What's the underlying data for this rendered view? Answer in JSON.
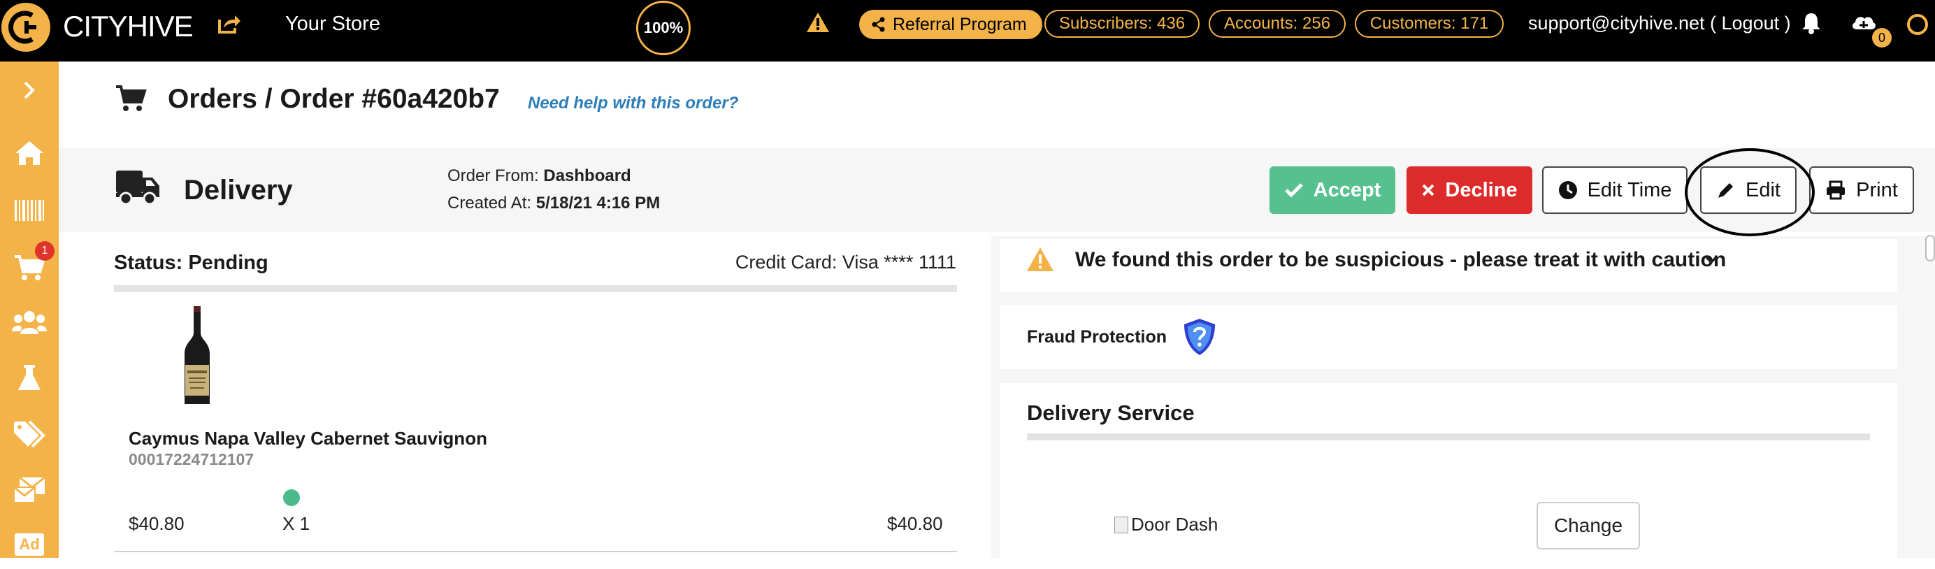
{
  "topbar": {
    "brand": "CITYHIVE",
    "store": "Your Store",
    "percent": "100%",
    "referral": "Referral Program",
    "subscribers": "Subscribers: 436",
    "accounts": "Accounts: 256",
    "customers": "Customers: 171",
    "support": "support@cityhive.net ( Logout )",
    "cloud_badge": "0"
  },
  "sidebar": {
    "cart_badge": "1",
    "ad_label": "Ad"
  },
  "header": {
    "breadcrumb": "Orders / Order #60a420b7",
    "help_link": "Need help with this order?"
  },
  "delivery": {
    "title": "Delivery",
    "order_from_label": "Order From:",
    "order_from_value": "Dashboard",
    "created_label": "Created At:",
    "created_value": "5/18/21 4:16 PM"
  },
  "actions": {
    "accept": "Accept",
    "decline": "Decline",
    "edit_time": "Edit Time",
    "edit": "Edit",
    "print": "Print"
  },
  "order": {
    "status": "Status: Pending",
    "credit_card": "Credit Card: Visa **** 1111",
    "product_name": "Caymus Napa Valley Cabernet Sauvignon",
    "sku": "00017224712107",
    "unit_price": "$40.80",
    "quantity": "X 1",
    "line_total": "$40.80"
  },
  "warning": {
    "text": "We found this order to be suspicious - please treat it with caution"
  },
  "fraud": {
    "label": "Fraud Protection"
  },
  "delivery_service": {
    "title": "Delivery Service",
    "provider": "Door Dash",
    "change": "Change"
  },
  "colors": {
    "accent": "#f4b349",
    "accept": "#56c08f",
    "decline": "#dd2b2b",
    "link": "#2b7db8"
  }
}
